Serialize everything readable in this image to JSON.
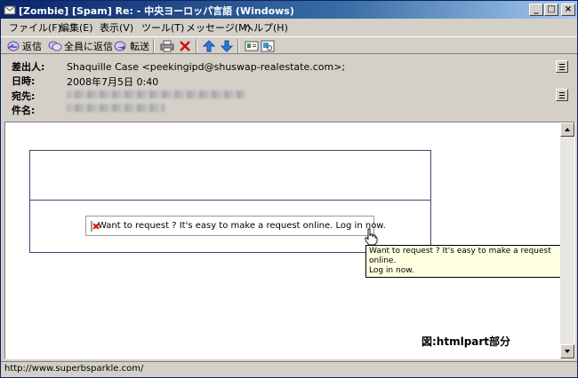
{
  "window": {
    "title": "[Zombie] [Spam]  Re: - 中央ヨーロッパ言語 (Windows)",
    "controls": {
      "minimize": "_",
      "maximize": "□",
      "close": "×"
    }
  },
  "menu": {
    "items": [
      {
        "label": "ファイル(F)"
      },
      {
        "label": "編集(E)"
      },
      {
        "label": "表示(V)"
      },
      {
        "label": "ツール(T)"
      },
      {
        "label": "メッセージ(M)"
      },
      {
        "label": "ヘルプ(H)"
      }
    ]
  },
  "toolbar": {
    "reply": "返信",
    "reply_all": "全員に返信",
    "forward": "転送"
  },
  "header": {
    "from_label": "差出人:",
    "from_value": "Shaquille Case <peekingipd@shuswap-realestate.com>;",
    "date_label": "日時:",
    "date_value": "2008年7月5日 0:40",
    "to_label": "宛先:",
    "subject_label": "件名:"
  },
  "message": {
    "image_alt": "Want to request ? It's easy to make a request online.  Log in now.",
    "tooltip_line1": "Want to request ? It's easy to make a request online.",
    "tooltip_line2": "Log in now.",
    "caption": "図:htmlpart部分"
  },
  "status": {
    "url": "http://www.superbsparkle.com/"
  },
  "colors": {
    "title_gradient_start": "#0a246a",
    "title_gradient_end": "#a6caf0",
    "chrome": "#d4d0c8",
    "tooltip_bg": "#ffffe1",
    "table_border": "#3c4a6e"
  }
}
